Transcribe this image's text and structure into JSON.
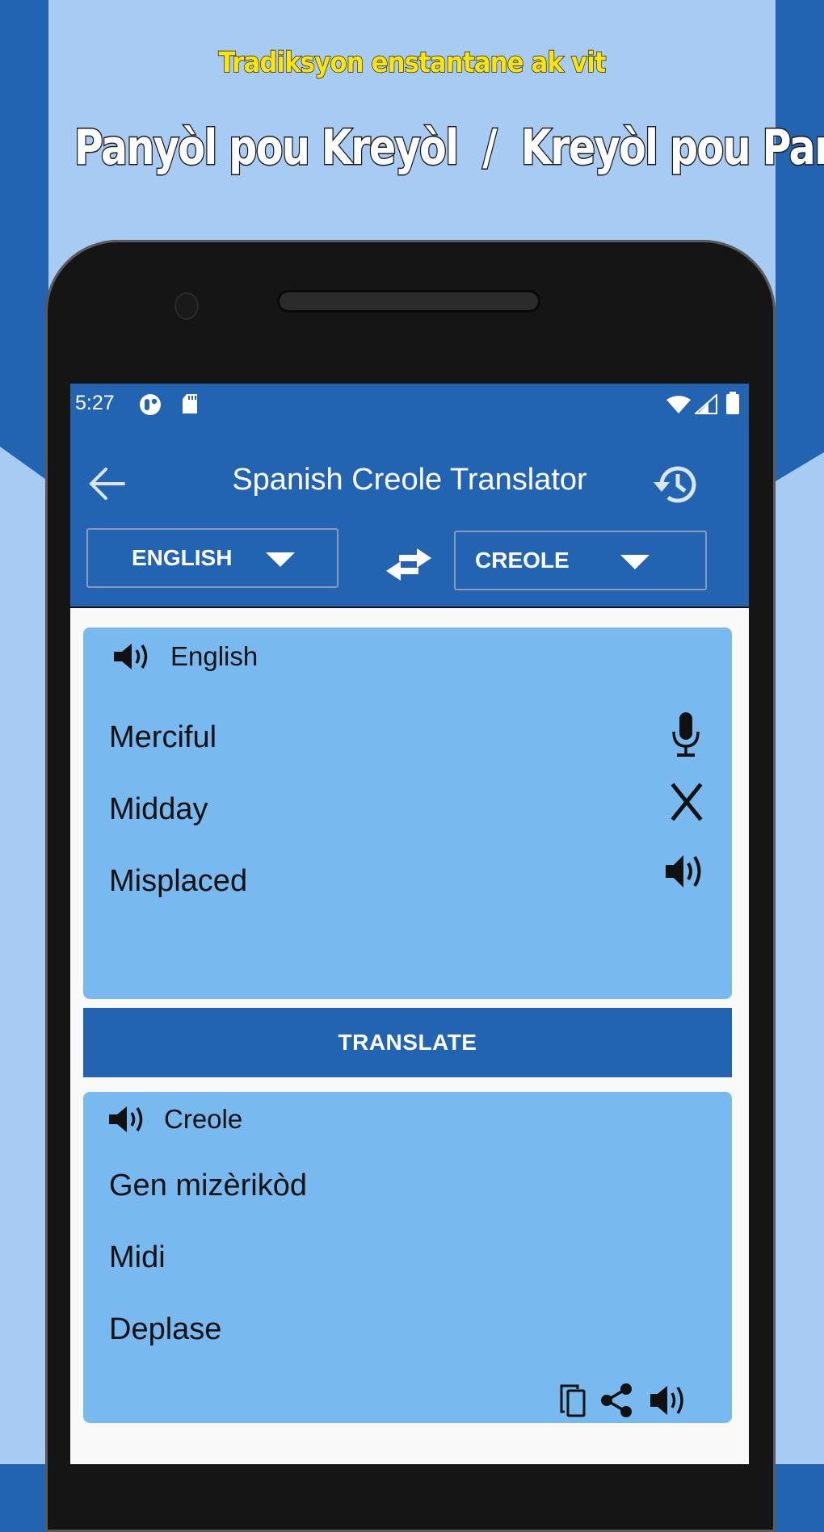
{
  "promo": {
    "subtitle": "Tradiksyon enstantane ak vit",
    "title": "Panyòl pou Kreyòl  /  Kreyòl pou Panyòl"
  },
  "colors": {
    "primary": "#2264b2",
    "card": "#78baf0",
    "promo_yellow": "#ffe600",
    "background_light": "#a8cbf3"
  },
  "status_bar": {
    "time": "5:27",
    "left_icons": [
      "notification-app-icon",
      "sd-card-icon"
    ],
    "right_icons": [
      "wifi-icon",
      "cell-signal-icon",
      "battery-icon"
    ]
  },
  "app_bar": {
    "title": "Spanish Creole Translator",
    "back_icon": "arrow-left-icon",
    "history_icon": "history-icon"
  },
  "languages": {
    "source": "ENGLISH",
    "target": "CREOLE",
    "swap_icon": "swap-arrows-icon"
  },
  "input_card": {
    "language_label": "English",
    "lines": [
      "Merciful",
      "Midday",
      "Misplaced"
    ],
    "actions": [
      "microphone-icon",
      "close-icon",
      "speaker-icon"
    ]
  },
  "translate_button": {
    "label": "TRANSLATE"
  },
  "output_card": {
    "language_label": "Creole",
    "lines": [
      "Gen mizèrikòd",
      "Midi",
      "Deplase"
    ],
    "actions": [
      "copy-icon",
      "share-icon",
      "speaker-icon"
    ]
  }
}
